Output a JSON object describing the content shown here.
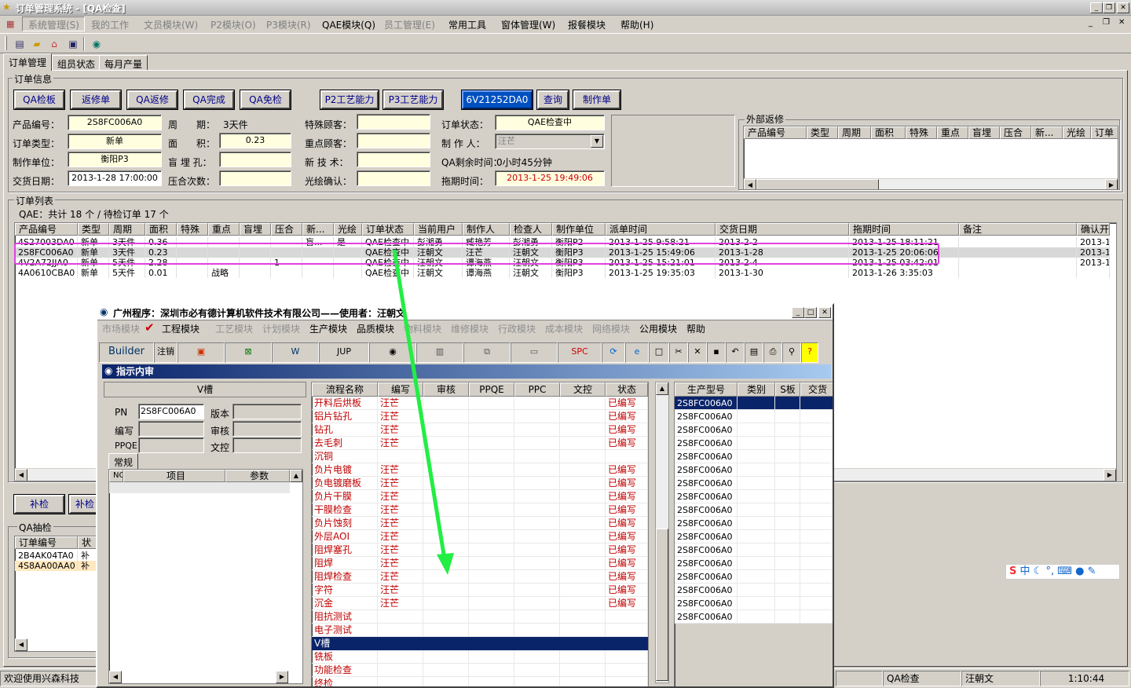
{
  "app": {
    "title": "订单管理系统 - [QA检查]"
  },
  "menu": [
    {
      "label": "系统管理(S)",
      "disabled": true
    },
    {
      "label": "我的工作",
      "disabled": true
    },
    {
      "label": "文员模块(W)",
      "disabled": true
    },
    {
      "label": "P2模块(O)",
      "disabled": true
    },
    {
      "label": "P3模块(R)",
      "disabled": true
    },
    {
      "label": "QAE模块(Q)",
      "disabled": false
    },
    {
      "label": "员工管理(E)",
      "disabled": true
    },
    {
      "label": "常用工具",
      "disabled": false
    },
    {
      "label": "窗体管理(W)",
      "disabled": false
    },
    {
      "label": "报餐模块",
      "disabled": false
    },
    {
      "label": "帮助(H)",
      "disabled": false
    }
  ],
  "tabs": [
    "订单管理",
    "组员状态",
    "每月产量"
  ],
  "order_info": {
    "group_label": "订单信息",
    "buttons": [
      "QA检板",
      "返修单",
      "QA返修",
      "QA完成",
      "QA免检",
      "P2工艺能力",
      "P3工艺能力",
      "查询",
      "制作单"
    ],
    "code_button": "6V21252DA0",
    "product_no_label": "产品编号：",
    "product_no": "2S8FC006A0",
    "period_label": "周　　期：",
    "period": "3天件",
    "special_customer_label": "特殊顾客：",
    "order_status_label": "订单状态：",
    "order_status": "QAE检查中",
    "order_type_label": "订单类型：",
    "order_type": "新单",
    "area_label": "面　　积：",
    "area": "0.23",
    "key_customer_label": "重点顾客：",
    "maker_label": "制 作 人：",
    "maker": "汪芒",
    "unit_label": "制作单位：",
    "unit": "衡阳P3",
    "blind_hole_label": "盲 埋 孔：",
    "new_tech_label": "新 技 术：",
    "qa_remaining_label": "QA剩余时间：",
    "qa_remaining": "0小时45分钟",
    "delivery_label": "交货日期：",
    "delivery": "2013-1-28 17:00:00",
    "press_label": "压合次数：",
    "optical_label": "光绘确认：",
    "delay_label": "拖期时间：",
    "delay": "2013-1-25 19:49:06"
  },
  "external_repair": {
    "group_label": "外部返修",
    "columns": [
      "产品编号",
      "类型",
      "周期",
      "面积",
      "特殊",
      "重点",
      "盲埋",
      "压合",
      "新...",
      "光绘",
      "订单"
    ]
  },
  "order_list": {
    "group_label": "订单列表",
    "summary": "QAE：共计 18 个 / 待检订单 17 个",
    "columns": [
      "产品编号",
      "类型",
      "周期",
      "面积",
      "特殊",
      "重点",
      "盲埋",
      "压合",
      "新...",
      "光绘",
      "订单状态",
      "当前用户",
      "制作人",
      "检查人",
      "制作单位",
      "派单时间",
      "交货日期",
      "拖期时间",
      "备注",
      "确认开"
    ],
    "rows": [
      [
        "4S27003DA0",
        "新单",
        "3天件",
        "0.36",
        "",
        "",
        "",
        "",
        "盲...",
        "是",
        "QAE检查中",
        "彭湘勇",
        "臧艳芳",
        "彭湘勇",
        "衡阳P2",
        "2013-1-25 9:58:21",
        "2013-2-2",
        "2013-1-25 18:11:21",
        "",
        "2013-1-"
      ],
      [
        "2S8FC006A0",
        "新单",
        "3天件",
        "0.23",
        "",
        "",
        "",
        "",
        "",
        "",
        "QAE检查中",
        "汪朝文",
        "汪芒",
        "汪朝文",
        "衡阳P3",
        "2013-1-25 15:49:06",
        "2013-1-28",
        "2013-1-25 20:06:06",
        "",
        "2013-1-"
      ],
      [
        "4V2A72JJA0",
        "新单",
        "5天件",
        "2.28",
        "",
        "",
        "",
        "1",
        "",
        "",
        "QAE检查中",
        "汪朝文",
        "谭海燕",
        "汪朝文",
        "衡阳P3",
        "2013-1-25 15:21:01",
        "2013-2-4",
        "2013-1-25 03:42:01",
        "",
        "2013-1-"
      ],
      [
        "4A0610CBA0",
        "新单",
        "5天件",
        "0.01",
        "",
        "战略",
        "",
        "",
        "",
        "",
        "QAE检查中",
        "汪朝文",
        "谭海燕",
        "汪朝文",
        "衡阳P3",
        "2013-1-25 19:35:03",
        "2013-1-30",
        "2013-1-26 3:35:03",
        "",
        ""
      ]
    ]
  },
  "bottom_left": {
    "buttons": [
      "补检",
      "补检"
    ],
    "group_label": "QA抽检",
    "columns": [
      "订单编号",
      "状"
    ],
    "rows": [
      [
        "2B4AK04TA0",
        "补"
      ],
      [
        "4S8AA00AA0",
        "补"
      ]
    ]
  },
  "status_bar": {
    "welcome": "欢迎使用兴森科技",
    "module": "QA检查",
    "user": "汪朝文",
    "time": "1:10:44"
  },
  "inner_window": {
    "title": "广州程序：深圳市必有德计算机软件技术有限公司——使用者：汪朝文",
    "menu": [
      {
        "label": "市场模块",
        "disabled": true
      },
      {
        "label": "工程模块",
        "disabled": false
      },
      {
        "label": "工艺模块",
        "disabled": true
      },
      {
        "label": "计划模块",
        "disabled": true
      },
      {
        "label": "生产模块",
        "disabled": false
      },
      {
        "label": "品质模块",
        "disabled": false
      },
      {
        "label": "物料模块",
        "disabled": true
      },
      {
        "label": "维修模块",
        "disabled": true
      },
      {
        "label": "行政模块",
        "disabled": true
      },
      {
        "label": "成本模块",
        "disabled": true
      },
      {
        "label": "网络模块",
        "disabled": true
      },
      {
        "label": "公用模块",
        "disabled": false
      },
      {
        "label": "帮助",
        "disabled": false
      }
    ],
    "toolbar": [
      "Builder",
      "注销",
      "JUP",
      "SPC"
    ],
    "subtitle": "指示内审",
    "vslot_label": "V槽",
    "pn_label": "PN",
    "pn": "2S8FC006A0",
    "version_label": "版本",
    "writer_label": "编写",
    "reviewer_label": "审核",
    "ppqe_label": "PPQE",
    "doc_control_label": "文控",
    "normal_tab": "常规",
    "params_columns": [
      "NO",
      "项目",
      "参数"
    ],
    "flow_columns": [
      "流程名称",
      "编写",
      "审核",
      "PPQE",
      "PPC",
      "文控",
      "状态"
    ],
    "flow_rows": [
      [
        "开料后烘板",
        "汪芒",
        "已编写"
      ],
      [
        "铝片钻孔",
        "汪芒",
        "已编写"
      ],
      [
        "钻孔",
        "汪芒",
        "已编写"
      ],
      [
        "去毛刺",
        "汪芒",
        "已编写"
      ],
      [
        "沉铜",
        "",
        ""
      ],
      [
        "负片电镀",
        "汪芒",
        "已编写"
      ],
      [
        "负电镀磨板",
        "汪芒",
        "已编写"
      ],
      [
        "负片干膜",
        "汪芒",
        "已编写"
      ],
      [
        "干膜检查",
        "汪芒",
        "已编写"
      ],
      [
        "负片蚀刻",
        "汪芒",
        "已编写"
      ],
      [
        "外层AOI",
        "汪芒",
        "已编写"
      ],
      [
        "阻焊塞孔",
        "汪芒",
        "已编写"
      ],
      [
        "阻焊",
        "汪芒",
        "已编写"
      ],
      [
        "阻焊检查",
        "汪芒",
        "已编写"
      ],
      [
        "字符",
        "汪芒",
        "已编写"
      ],
      [
        "沉金",
        "汪芒",
        "已编写"
      ],
      [
        "阻抗测试",
        "",
        ""
      ],
      [
        "电子测试",
        "",
        ""
      ],
      [
        "V槽",
        "",
        ""
      ],
      [
        "铣板",
        "",
        ""
      ],
      [
        "功能检查",
        "",
        ""
      ],
      [
        "终检",
        "",
        ""
      ]
    ],
    "selected_flow": "V槽",
    "type_columns": [
      "生产型号",
      "类别",
      "S板",
      "交货"
    ],
    "type_rows": [
      "2S8FC006A0",
      "2S8FC006A0",
      "2S8FC006A0",
      "2S8FC006A0",
      "2S8FC006A0",
      "2S8FC006A0",
      "2S8FC006A0",
      "2S8FC006A0",
      "2S8FC006A0",
      "2S8FC006A0",
      "2S8FC006A0",
      "2S8FC006A0",
      "2S8FC006A0",
      "2S8FC006A0",
      "2S8FC006A0",
      "2S8FC006A0",
      "2S8FC006A0"
    ]
  },
  "ime": {
    "lang": "中"
  },
  "colors": {
    "highlight": "#e040e0",
    "arrow": "#22ee44",
    "selection": "#0a246a",
    "flow_text": "#c00000"
  }
}
